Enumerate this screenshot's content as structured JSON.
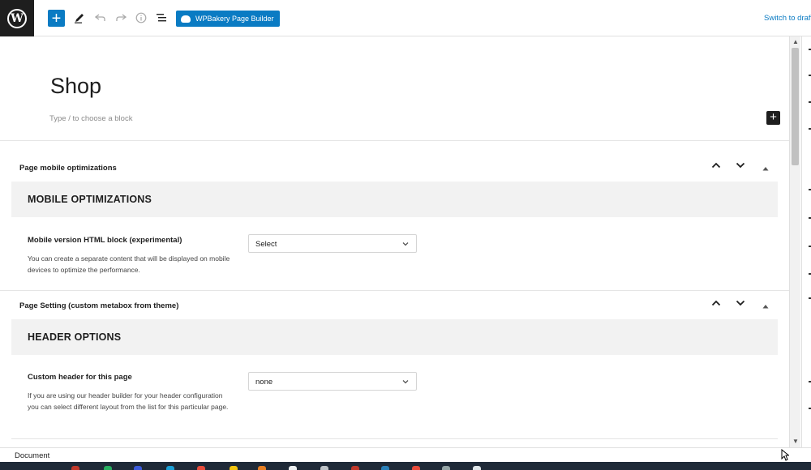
{
  "topbar": {
    "logo": "W",
    "add_label": "+",
    "tool_icons": [
      "pencil-icon",
      "undo-icon",
      "redo-icon",
      "info-icon",
      "list-view-icon"
    ],
    "wpbakery_label": "WPBakery Page Builder",
    "switch_to_draft": "Switch to draft"
  },
  "editor": {
    "title": "Shop",
    "block_placeholder": "Type / to choose a block",
    "add_block": "+"
  },
  "panels": [
    {
      "heading": "Page mobile optimizations",
      "section_title": "MOBILE OPTIMIZATIONS",
      "field_label": "Mobile version HTML block (experimental)",
      "field_desc": "You can create a separate content that will be displayed on mobile devices to optimize the performance.",
      "select_value": "Select"
    },
    {
      "heading": "Page Setting (custom metabox from theme)",
      "section_title": "HEADER OPTIONS",
      "field_label": "Custom header for this page",
      "field_desc": "If you are using our header builder for your header configuration you can select different layout from the list for this particular page.",
      "select_value": "none"
    }
  ],
  "panel_controls": {
    "up": "⌃",
    "down": "⌄",
    "toggle": "▲"
  },
  "statusbar": {
    "label": "Document"
  },
  "colors": {
    "accent": "#0a7bc3",
    "band": "#f2f2f2",
    "dark": "#1e1e1e"
  }
}
